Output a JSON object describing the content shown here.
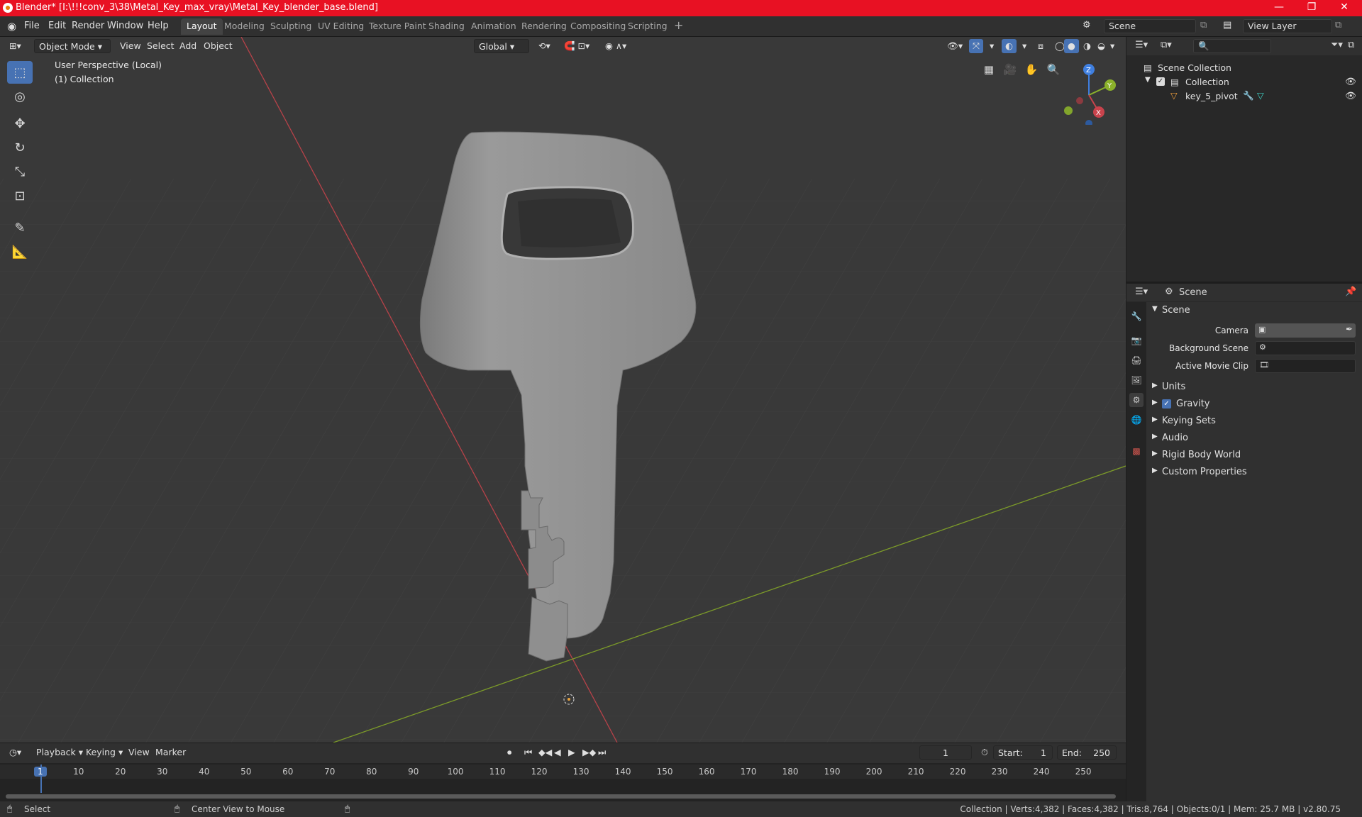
{
  "window": {
    "title": "Blender* [I:\\!!!conv_3\\38\\Metal_Key_max_vray\\Metal_Key_blender_base.blend]",
    "controls": [
      "—",
      "❐",
      "✕"
    ]
  },
  "menus": [
    "File",
    "Edit",
    "Render",
    "Window",
    "Help"
  ],
  "workspaces": [
    "Layout",
    "Modeling",
    "Sculpting",
    "UV Editing",
    "Texture Paint",
    "Shading",
    "Animation",
    "Rendering",
    "Compositing",
    "Scripting"
  ],
  "workspace_add": "+",
  "scene_selector": "Scene",
  "viewlayer_selector": "View Layer",
  "viewport": {
    "mode": "Object Mode",
    "menu": [
      "View",
      "Select",
      "Add",
      "Object"
    ],
    "orientation": "Global",
    "overlay_line1": "User Perspective (Local)",
    "overlay_line2": "(1) Collection",
    "gizmo_axes": {
      "x": "X",
      "y": "Y",
      "z": "Z"
    }
  },
  "outliner": {
    "root": "Scene Collection",
    "collection": "Collection",
    "object": "key_5_pivot"
  },
  "properties": {
    "header": "Scene",
    "panel": "Scene",
    "camera_label": "Camera",
    "background_scene_label": "Background Scene",
    "movie_clip_label": "Active Movie Clip",
    "sections": [
      "Units",
      "Gravity",
      "Keying Sets",
      "Audio",
      "Rigid Body World",
      "Custom Properties"
    ],
    "gravity_checked": true
  },
  "timeline": {
    "menus": [
      "Playback",
      "Keying",
      "View",
      "Marker"
    ],
    "current_frame": "1",
    "start_label": "Start:",
    "start": "1",
    "end_label": "End:",
    "end": "250",
    "ticks": [
      "1",
      "10",
      "20",
      "30",
      "40",
      "50",
      "60",
      "70",
      "80",
      "90",
      "100",
      "110",
      "120",
      "130",
      "140",
      "150",
      "160",
      "170",
      "180",
      "190",
      "200",
      "210",
      "220",
      "230",
      "240",
      "250"
    ]
  },
  "statusbar": {
    "select": "Select",
    "center": "Center View to Mouse",
    "stats": "Collection | Verts:4,382 | Faces:4,382 | Tris:8,764 | Objects:0/1 | Mem: 25.7 MB | v2.80.75"
  },
  "colors": {
    "titlebar": "#e81123",
    "accent": "#4772b3",
    "x_axis": "#c8434c",
    "y_axis": "#8bb12b",
    "z_axis": "#3f7fe0",
    "viewport_bg": "#393939"
  }
}
